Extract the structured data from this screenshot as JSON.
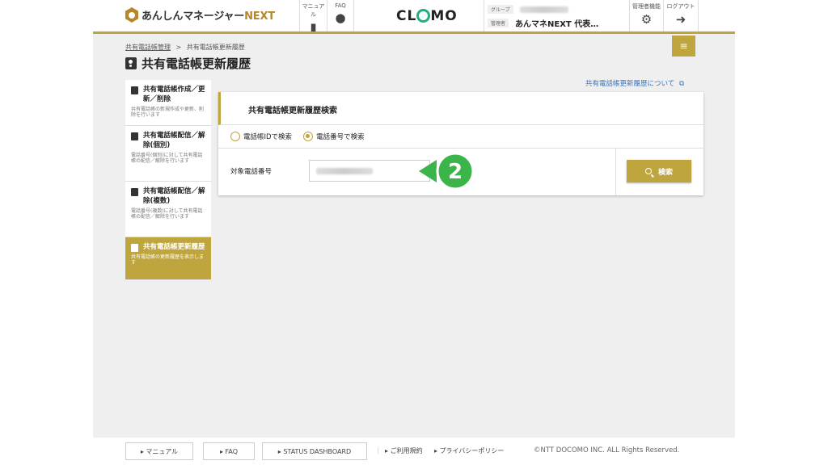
{
  "header": {
    "logo_text": "あんしんマネージャー",
    "logo_accent": "NEXT",
    "manual_label": "マニュアル",
    "faq_label": "FAQ",
    "brand_left": "CL",
    "brand_right": "MO",
    "group_label": "グループ",
    "admin_label": "管理者",
    "group_name": "あんマネNEXT 代表…",
    "admin_func_label": "管理者機能",
    "logout_label": "ログアウト",
    "menu_glyph": "≡"
  },
  "breadcrumb": {
    "parent": "共有電話帳管理",
    "separator": ">",
    "current": "共有電話帳更新履歴"
  },
  "page_title": "共有電話帳更新履歴",
  "help_link": "共有電話帳更新履歴について",
  "sidebar": {
    "items": [
      {
        "title": "共有電話帳作成／更新／削除",
        "desc": "共有電話帳の新規作成や更新、削除を行います"
      },
      {
        "title": "共有電話帳配信／解除(個別)",
        "desc": "電話番号(個別)に対して共有電話帳の配信／解除を行います"
      },
      {
        "title": "共有電話帳配信／解除(複数)",
        "desc": "電話番号(複数)に対して共有電話帳の配信／解除を行います"
      },
      {
        "title": "共有電話帳更新履歴",
        "desc": "共有電話帳の更新履歴を表示します"
      }
    ]
  },
  "panel": {
    "title": "共有電話帳更新履歴検索",
    "radio_id": "電話帳IDで検索",
    "radio_number": "電話番号で検索",
    "field_label": "対象電話番号",
    "search_label": "検索"
  },
  "step_badge": "2",
  "footer": {
    "manual": "マニュアル",
    "faq": "FAQ",
    "status": "STATUS DASHBOARD",
    "terms": "ご利用規約",
    "privacy": "プライバシーポリシー",
    "copyright": "©NTT DOCOMO INC. ALL Rights Reserved."
  },
  "colors": {
    "accent": "#bfa53e",
    "brand_green": "#19b37e",
    "link": "#3a74b8",
    "badge": "#3bb54a"
  }
}
